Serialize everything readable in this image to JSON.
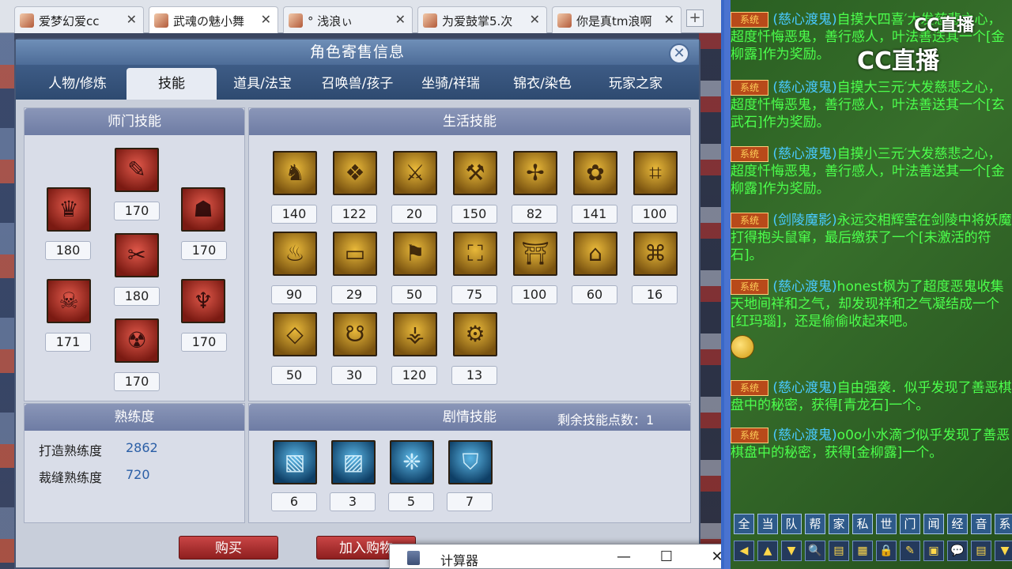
{
  "browser_tabs": [
    {
      "title": "爱梦幻爱cc",
      "close": "✕"
    },
    {
      "title": "武魂の魅小舞",
      "close": "✕"
    },
    {
      "title": "° 浅浪ぃ",
      "close": "✕"
    },
    {
      "title": "为爱鼓掌5.次",
      "close": "✕"
    },
    {
      "title": "你是真tm浪啊",
      "close": "✕"
    }
  ],
  "new_tab": "+",
  "dialog": {
    "title": "角色寄售信息",
    "close": "✕",
    "tabs": [
      "人物/修炼",
      "技能",
      "道具/法宝",
      "召唤兽/孩子",
      "坐骑/祥瑞",
      "锦衣/染色",
      "玩家之家"
    ],
    "active_tab": "技能",
    "school_skills": {
      "header": "师门技能",
      "levels": [
        "170",
        "180",
        "180",
        "170",
        "171",
        "170",
        "170"
      ]
    },
    "life_skills": {
      "header": "生活技能",
      "levels": [
        "140",
        "122",
        "20",
        "150",
        "82",
        "141",
        "100",
        "90",
        "29",
        "50",
        "75",
        "100",
        "60",
        "16",
        "50",
        "30",
        "120",
        "13"
      ]
    },
    "proficiency": {
      "header": "熟练度",
      "items": [
        {
          "label": "打造熟练度",
          "value": "2862"
        },
        {
          "label": "裁缝熟练度",
          "value": "720"
        }
      ]
    },
    "story_skills": {
      "header": "剧情技能",
      "remaining_label": "剩余技能点数：",
      "remaining_value": "1",
      "levels": [
        "6",
        "3",
        "5",
        "7"
      ]
    },
    "buttons": {
      "buy": "购买",
      "add_cart": "加入购物"
    }
  },
  "calculator": {
    "title": "计算器",
    "minimize": "—",
    "maximize": "☐",
    "close": "✕"
  },
  "chat": {
    "logo": "CC直播",
    "sys_tag": "系统",
    "messages": [
      {
        "who": "(慈心渡鬼)",
        "text": "自摸大四喜′大发慈悲之心，超度忏悔恶鬼，善行感人，叶法善送其一个[金柳露]作为奖励。"
      },
      {
        "who": "(慈心渡鬼)",
        "text": "自摸大三元′大发慈悲之心，超度忏悔恶鬼，善行感人，叶法善送其一个[玄武石]作为奖励。"
      },
      {
        "who": "(慈心渡鬼)",
        "text": "自摸小三元′大发慈悲之心，超度忏悔恶鬼，善行感人，叶法善送其一个[金柳露]作为奖励。"
      },
      {
        "who": "(剑陵魔影)",
        "text": "永远交相辉莹在剑陵中将妖魔打得抱头鼠窜，最后缴获了一个[未激活的符石]。"
      },
      {
        "who": "(慈心渡鬼)",
        "text": "honest枫为了超度恶鬼收集天地间祥和之气，却发现祥和之气凝结成一个[红玛瑙]，还是偷偷收起来吧。"
      },
      {
        "who": "(慈心渡鬼)",
        "text": "自由强袭．似乎发现了善恶棋盘中的秘密，获得[青龙石]一个。"
      },
      {
        "who": "(慈心渡鬼)",
        "text": "o0o小水滴づ似乎发现了善恶棋盘中的秘密，获得[金柳露]一个。"
      }
    ],
    "channels": [
      "全",
      "当",
      "队",
      "帮",
      "家",
      "私",
      "世",
      "门",
      "闻",
      "经",
      "音",
      "系"
    ],
    "tools": [
      "◀",
      "▲",
      "▼",
      "🔍",
      "▤",
      "▦",
      "🔒",
      "✎",
      "▣",
      "💬",
      "▤",
      "▼"
    ]
  }
}
